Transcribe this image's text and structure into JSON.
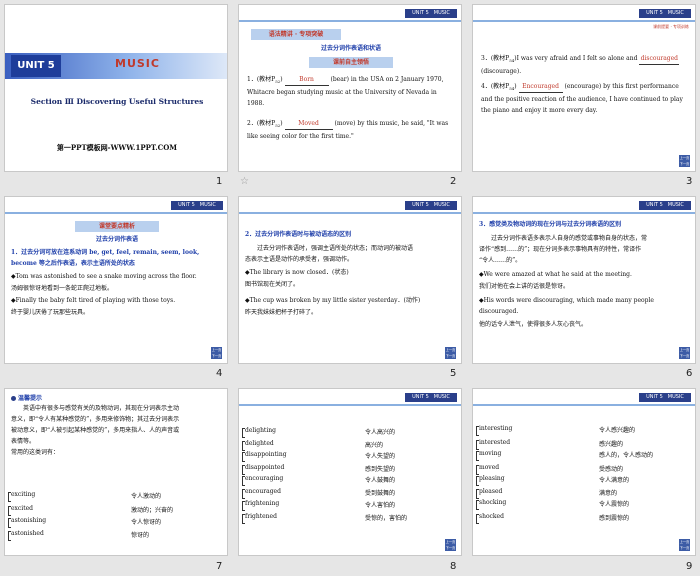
{
  "slide_numbers": [
    "1",
    "2",
    "3",
    "4",
    "5",
    "6",
    "7",
    "8",
    "9"
  ],
  "header_tag": "UNIT 5　MUSIC",
  "corner_icon": "上一页 下一页",
  "s1": {
    "unit": "UNIT 5",
    "title": "MUSIC",
    "section": "Section Ⅲ  Discovering Useful Structures",
    "site": "第一PPT模板网-WWW.1PPT.COM"
  },
  "s2": {
    "tag": "语法精讲 · 专项突破",
    "heading": "过去分词作表语和状语",
    "banner": "课前自主领悟",
    "l1a": "1．(教材P",
    "l1b": ")",
    "l1c": "(bear) in the USA on 2 January 1970,",
    "l1d": "Whitacre began studying music at the University of Nevada in",
    "l1e": "1988.",
    "sub1": "52",
    "ans1": "Born",
    "l2a": "2．(教材P",
    "l2b": ")",
    "l2c": "(move) by this music, he said, \"It was",
    "l2d": "like seeing color for the first time.\"",
    "sub2": "52",
    "ans2": "Moved",
    "star": "☆"
  },
  "s3": {
    "tag2": "课前提要 · 专项训练",
    "l3a": "3．(教材P",
    "l3b": ")I was very afraid and I felt so alone and",
    "l3c": "(discourage).",
    "sub3": "54",
    "ans3": "discouraged",
    "l4a": "4．(教材P",
    "l4b": ")",
    "l4c": "(encourage) by this first performance",
    "l4d": "and the positive reaction of the audience, I have continued to play",
    "l4e": "the piano and enjoy it more every day.",
    "sub4": "54",
    "ans4": "Encouraged"
  },
  "s4": {
    "banner": "课堂要点精析",
    "heading": "过去分词作表语",
    "p1": "1．过去分词可放在连系动词 be, get, feel, remain, seem, look,",
    "p2": "become 等之后作表语，表示主语所处的状态",
    "e1": "◆Tom was astonished to see a snake moving across the floor.",
    "c1": "汤姆很惊讶地看到一条蛇正爬过地板。",
    "e2": "◆Finally the baby felt tired of playing with those toys.",
    "c2": "终于婴儿厌倦了玩那些玩具。"
  },
  "s5": {
    "heading": "2．过去分词作表语时与被动语态的区别",
    "p1": "过去分词作表语时，强调主语所处的状态；而动词的被动语",
    "p2": "态表示主语是动作的承受者，强调动作。",
    "e1": "◆The library is now closed．(状态)",
    "c1": "图书馆现在关闭了。",
    "e2": "◆The cup was broken by my little sister yesterday．(动作)",
    "c2": "昨天我妹妹把杯子打碎了。"
  },
  "s6": {
    "heading": "3．感觉类及物动词的现在分词与过去分词表语的区别",
    "p1": "过去分词作表语多表示人自身的感觉或事物自身的状态，常",
    "p2": "译作“感到……的”；现在分词多表示事物具有的特性，常译作",
    "p3": "“令人……的”。",
    "e1": "◆We were amazed at what he said at the meeting.",
    "c1": "我们对他在会上讲的话很是惊讶。",
    "e2": "◆His words were discouraging, which made many people",
    "e3": "discouraged.",
    "c2": "他的话令人泄气，使得很多人灰心丧气。"
  },
  "s7": {
    "tip": "温馨提示",
    "p1": "英语中有很多与感觉有关的及物动词，其现在分词表示主动",
    "p2": "意义，即“令人有某种感觉的”，多用来修饰物；其过去分词表示",
    "p3": "被动意义，即“人被引起某种感觉的”，多用来指人、人的声音或",
    "p4": "表情等。",
    "p5": "常用的这类词有：",
    "rows": [
      {
        "w": "exciting",
        "m": "令人激动的"
      },
      {
        "w": "excited",
        "m": "激动的；兴奋的"
      },
      {
        "w": "astonishing",
        "m": "令人惊讶的"
      },
      {
        "w": "astonished",
        "m": "惊讶的"
      }
    ]
  },
  "s8": {
    "rows": [
      {
        "w": "delighting",
        "m": "令人高兴的"
      },
      {
        "w": "delighted",
        "m": "高兴的"
      },
      {
        "w": "disappointing",
        "m": "令人失望的"
      },
      {
        "w": "disappointed",
        "m": "感到失望的"
      },
      {
        "w": "encouraging",
        "m": "令人鼓舞的"
      },
      {
        "w": "encouraged",
        "m": "受到鼓舞的"
      },
      {
        "w": "frightening",
        "m": "令人害怕的"
      },
      {
        "w": "frightened",
        "m": "受惊的，害怕的"
      }
    ]
  },
  "s9": {
    "rows": [
      {
        "w": "interesting",
        "m": "令人感兴趣的"
      },
      {
        "w": "interested",
        "m": "感兴趣的"
      },
      {
        "w": "moving",
        "m": "感人的，令人感动的"
      },
      {
        "w": "moved",
        "m": "受感动的"
      },
      {
        "w": "pleasing",
        "m": "令人满意的"
      },
      {
        "w": "pleased",
        "m": "满意的"
      },
      {
        "w": "shocking",
        "m": "令人震惊的"
      },
      {
        "w": "shocked",
        "m": "感到震惊的"
      }
    ]
  }
}
